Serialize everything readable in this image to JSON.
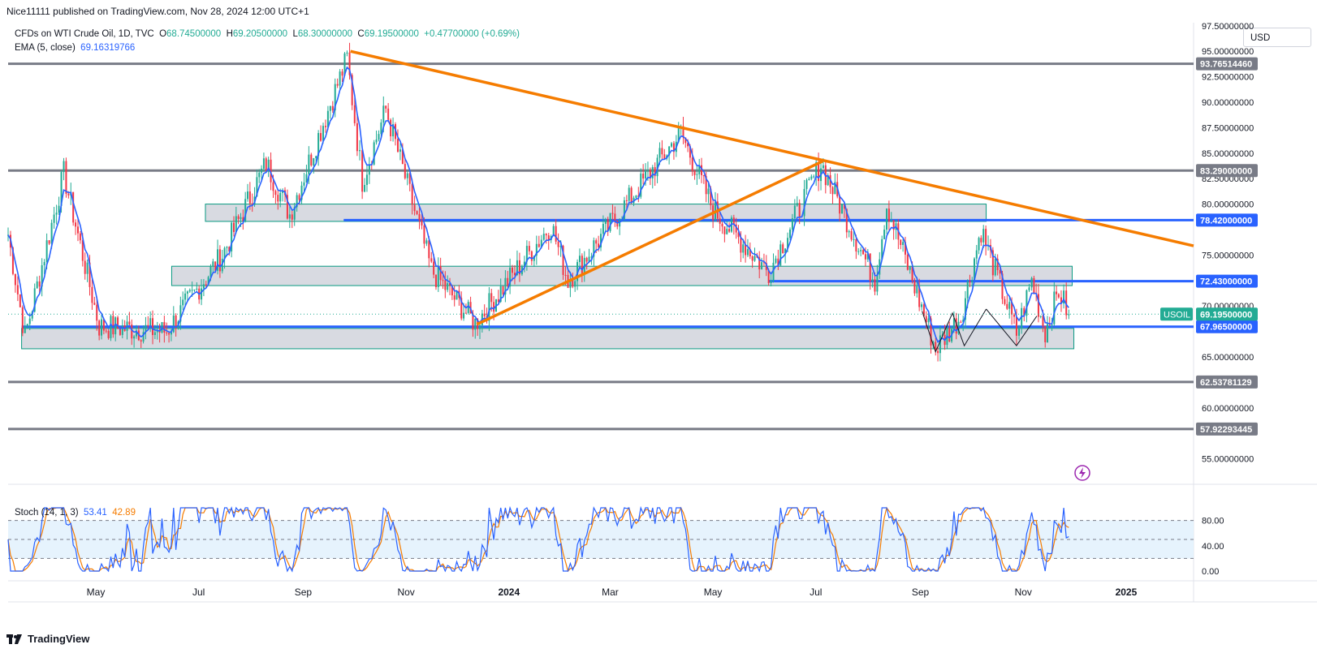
{
  "header": {
    "publisher_line": "Nice11111 published on TradingView.com, Nov 28, 2024 12:00 UTC+1"
  },
  "legend": {
    "symbol": "CFDs on WTI Crude Oil, 1D, TVC",
    "open_label": "O",
    "open": "68.74500000",
    "high_label": "H",
    "high": "69.20500000",
    "low_label": "L",
    "low": "68.30000000",
    "close_label": "C",
    "close": "69.19500000",
    "change": "+0.47700000 (+0.69%)",
    "ema_label": "EMA (5, close)",
    "ema_value": "69.16319766"
  },
  "stoch_legend": {
    "label": "Stoch (14, 1, 3)",
    "k": "53.41",
    "d": "42.89"
  },
  "currency": "USD",
  "footer": {
    "brand": "TradingView"
  },
  "colors": {
    "up": "#22ab94",
    "down": "#f23645",
    "ema": "#2962ff",
    "trend": "#f57c00",
    "hline": "#787b86",
    "blue_line": "#2962ff",
    "zone_fill": "#d1d4dc",
    "zone_border": "#089981",
    "stoch_band": "#e3f2fd"
  },
  "chart_data": [
    {
      "type": "candlestick",
      "title": "CFDs on WTI Crude Oil, 1D, TVC",
      "ylim": [
        52.5,
        97.8
      ],
      "y_ticks": [
        55,
        60,
        65,
        70,
        75,
        80,
        85,
        90,
        95
      ],
      "y_tick_labels": [
        "55.00000000",
        "60.00000000",
        "65.00000000",
        "70.00000000",
        "75.00000000",
        "80.00000000",
        "82.50000000",
        "85.00000000",
        "87.50000000",
        "90.00000000",
        "92.50000000",
        "95.00000000",
        "97.50000000"
      ],
      "x_labels": [
        "May",
        "Jul",
        "Sep",
        "Nov",
        "2024",
        "Mar",
        "May",
        "Jul",
        "Sep",
        "Nov",
        "2025"
      ],
      "x_range": [
        "2023-03-10",
        "2025-02-10"
      ],
      "series": [
        {
          "name": "EMA (5, close)",
          "kind": "line"
        }
      ],
      "key_points": [
        {
          "date": "2023-03-10",
          "price": 77.0
        },
        {
          "date": "2023-03-20",
          "price": 67.0
        },
        {
          "date": "2023-04-12",
          "price": 83.0
        },
        {
          "date": "2023-05-03",
          "price": 68.0
        },
        {
          "date": "2023-06-12",
          "price": 67.5
        },
        {
          "date": "2023-07-15",
          "price": 75.0
        },
        {
          "date": "2023-08-10",
          "price": 84.0
        },
        {
          "date": "2023-08-24",
          "price": 79.0
        },
        {
          "date": "2023-09-27",
          "price": 94.3
        },
        {
          "date": "2023-10-06",
          "price": 82.3
        },
        {
          "date": "2023-10-20",
          "price": 89.3
        },
        {
          "date": "2023-11-16",
          "price": 73.5
        },
        {
          "date": "2023-12-12",
          "price": 68.3
        },
        {
          "date": "2024-01-03",
          "price": 73.0
        },
        {
          "date": "2024-01-26",
          "price": 78.0
        },
        {
          "date": "2024-02-05",
          "price": 72.5
        },
        {
          "date": "2024-03-15",
          "price": 81.0
        },
        {
          "date": "2024-04-12",
          "price": 87.0
        },
        {
          "date": "2024-05-01",
          "price": 79.5
        },
        {
          "date": "2024-06-03",
          "price": 73.3
        },
        {
          "date": "2024-07-04",
          "price": 84.0
        },
        {
          "date": "2024-08-05",
          "price": 72.5
        },
        {
          "date": "2024-08-12",
          "price": 80.0
        },
        {
          "date": "2024-09-10",
          "price": 65.8
        },
        {
          "date": "2024-09-25",
          "price": 69.0
        },
        {
          "date": "2024-10-07",
          "price": 77.5
        },
        {
          "date": "2024-10-28",
          "price": 67.3
        },
        {
          "date": "2024-11-06",
          "price": 72.5
        },
        {
          "date": "2024-11-14",
          "price": 67.5
        },
        {
          "date": "2024-11-22",
          "price": 71.5
        },
        {
          "date": "2024-11-28",
          "price": 69.195
        }
      ],
      "horizontal_lines": [
        {
          "price": 93.7651446,
          "label": "93.76514460",
          "color": "#787b86"
        },
        {
          "price": 83.29,
          "label": "83.29000000",
          "color": "#787b86"
        },
        {
          "price": 78.42,
          "label": "78.42000000",
          "color": "#2962ff"
        },
        {
          "price": 72.43,
          "label": "72.43000000",
          "color": "#2962ff"
        },
        {
          "price": 67.965,
          "label": "67.96500000",
          "color": "#2962ff"
        },
        {
          "price": 62.53781129,
          "label": "62.53781129",
          "color": "#787b86"
        },
        {
          "price": 57.92293445,
          "label": "57.92293445",
          "color": "#787b86"
        }
      ],
      "current_price": {
        "symbol": "USOIL",
        "price": "69.19500000"
      },
      "zones": [
        {
          "from": "2023-07-05",
          "to": "2024-10-10",
          "top": 80.0,
          "bottom": 78.3
        },
        {
          "from": "2023-06-15",
          "to": "2024-11-30",
          "top": 73.9,
          "bottom": 72.0
        },
        {
          "from": "2023-03-18",
          "to": "2024-12-01",
          "top": 67.8,
          "bottom": 65.8
        }
      ],
      "trendlines": [
        {
          "from": {
            "date": "2023-09-29",
            "price": 95.0
          },
          "to": {
            "date": "2025-02-10",
            "price": 75.9
          }
        },
        {
          "from": {
            "date": "2023-12-13",
            "price": 68.2
          },
          "to": {
            "date": "2024-07-05",
            "price": 84.2
          }
        }
      ]
    },
    {
      "type": "line",
      "title": "Stoch (14, 1, 3)",
      "ylim": [
        0,
        100
      ],
      "y_ticks": [
        0,
        40,
        80
      ],
      "y_tick_labels": [
        "0.00",
        "40.00",
        "80.00"
      ],
      "band": [
        20,
        80
      ],
      "series": [
        {
          "name": "%K",
          "color": "#2962ff",
          "last": 53.41
        },
        {
          "name": "%D",
          "color": "#f57c00",
          "last": 42.89
        }
      ]
    }
  ]
}
